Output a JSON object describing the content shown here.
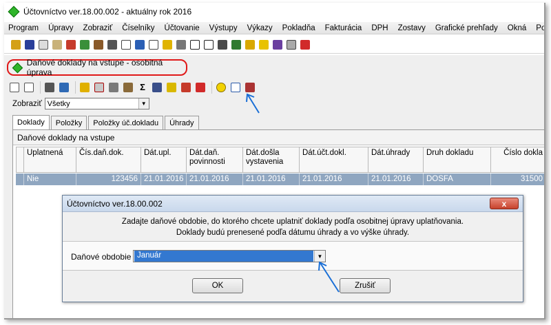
{
  "window": {
    "title": "Účtovníctvo ver.18.00.002  - aktuálny rok 2016"
  },
  "menu": [
    "Program",
    "Úpravy",
    "Zobraziť",
    "Číselníky",
    "Účtovanie",
    "Výstupy",
    "Výkazy",
    "Pokladňa",
    "Fakturácia",
    "DPH",
    "Zostavy",
    "Grafické prehľady",
    "Okná",
    "Pomo"
  ],
  "subwindow": {
    "title": "Daňové doklady na vstupe - osobitná úprava"
  },
  "filter": {
    "label": "Zobraziť",
    "value": "Všetky"
  },
  "tabs": [
    "Doklady",
    "Položky",
    "Položky úč.dokladu",
    "Úhrady"
  ],
  "panel": {
    "title": "Daňové doklady na vstupe"
  },
  "grid": {
    "columns": [
      "Uplatnená",
      "Čís.daň.dok.",
      "Dát.upl.",
      "Dát.daň. povinnosti",
      "Dát.došla vystavenia",
      "Dát.účt.dokl.",
      "Dát.úhrady",
      "Druh dokladu",
      "Číslo dokla"
    ],
    "rows": [
      [
        "Nie",
        "123456",
        "21.01.2016",
        "21.01.2016",
        "21.01.2016",
        "21.01.2016",
        "21.01.2016",
        "DOSFA",
        "31500"
      ]
    ]
  },
  "dialog": {
    "title": "Účtovníctvo ver.18.00.002",
    "close_label": "x",
    "message_line1": "Zadajte daňové obdobie, do ktorého chcete uplatniť doklady podľa osobitnej úpravy uplatňovania.",
    "message_line2": "Doklady budú prenesené podľa dátumu úhrady a vo výške úhrady.",
    "field_label": "Daňové obdobie",
    "field_value": "Január",
    "ok_label": "OK",
    "cancel_label": "Zrušiť"
  },
  "colors": {
    "accent_highlight": "#e01818",
    "arrow": "#1a6fd6",
    "selected_row": "#8fa6c0",
    "selected_value": "#3378d0"
  }
}
